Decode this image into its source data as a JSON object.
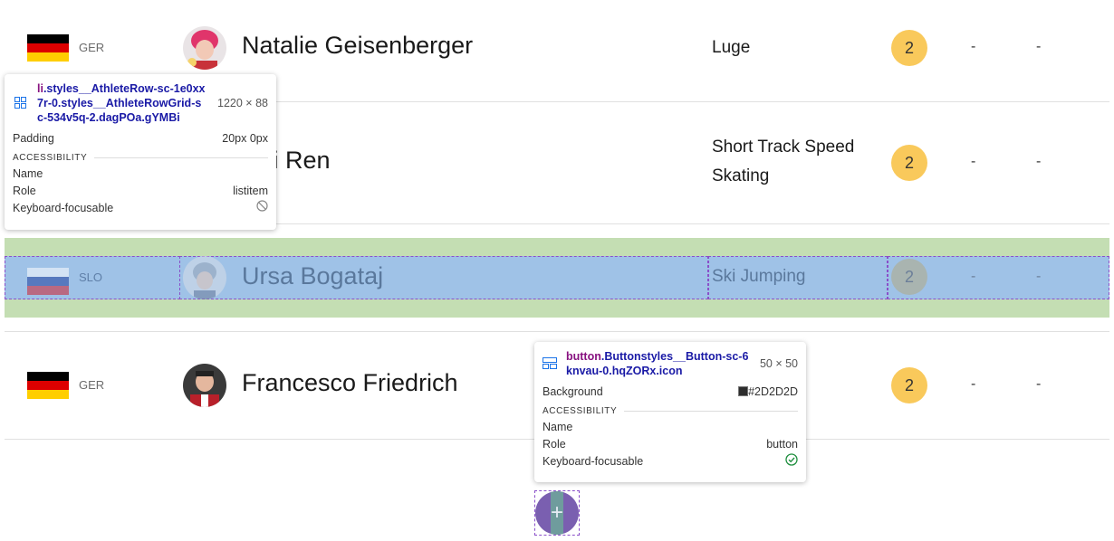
{
  "athletes": [
    {
      "country": "GER",
      "name": "Natalie Geisenberger",
      "sport": "Luge",
      "medals": "2",
      "col2": "-",
      "col3": "-"
    },
    {
      "country": "",
      "name": "wei Ren",
      "sport": "Short Track Speed Skating",
      "medals": "2",
      "col2": "-",
      "col3": "-"
    },
    {
      "country": "SLO",
      "name": "Ursa Bogataj",
      "sport": "Ski Jumping",
      "medals": "2",
      "col2": "-",
      "col3": "-"
    },
    {
      "country": "GER",
      "name": "Francesco Friedrich",
      "sport": "",
      "medals": "2",
      "col2": "-",
      "col3": "-"
    }
  ],
  "add_button": {
    "label": "+"
  },
  "tooltip_row": {
    "selector_tag": "li",
    "selector_class": ".styles__AthleteRow-sc-1e0xx7r-0.styles__AthleteRowGrid-sc-534v5q-2.dagPOa.gYMBi",
    "dims": "1220 × 88",
    "padding_label": "Padding",
    "padding_value": "20px 0px",
    "section": "ACCESSIBILITY",
    "name_label": "Name",
    "name_value": "",
    "role_label": "Role",
    "role_value": "listitem",
    "focus_label": "Keyboard-focusable"
  },
  "tooltip_button": {
    "selector_tag": "button",
    "selector_class": ".Buttonstyles__Button-sc-6knvau-0.hqZORx.icon",
    "dims": "50 × 50",
    "bg_label": "Background",
    "bg_value": "#2D2D2D",
    "section": "ACCESSIBILITY",
    "name_label": "Name",
    "name_value": "",
    "role_label": "Role",
    "role_value": "button",
    "focus_label": "Keyboard-focusable"
  },
  "colors": {
    "medal": "#f9c95b",
    "margin_highlight": "#c4deb3",
    "content_highlight": "#9fc2e7",
    "outline": "#8a4fc9"
  }
}
